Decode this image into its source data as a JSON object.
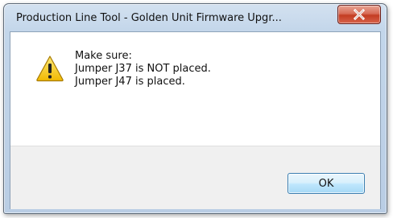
{
  "window": {
    "title": "Production Line Tool - Golden Unit Firmware Upgr...",
    "close_icon": "close-icon"
  },
  "message": {
    "icon": "warning-icon",
    "lines": [
      "Make sure:",
      "Jumper J37 is NOT placed.",
      "Jumper J47 is placed."
    ]
  },
  "buttons": {
    "ok_label": "OK"
  },
  "colors": {
    "close_button": "#c9452d",
    "warning_fill": "#f6c700",
    "ok_border": "#3c7fb1"
  }
}
